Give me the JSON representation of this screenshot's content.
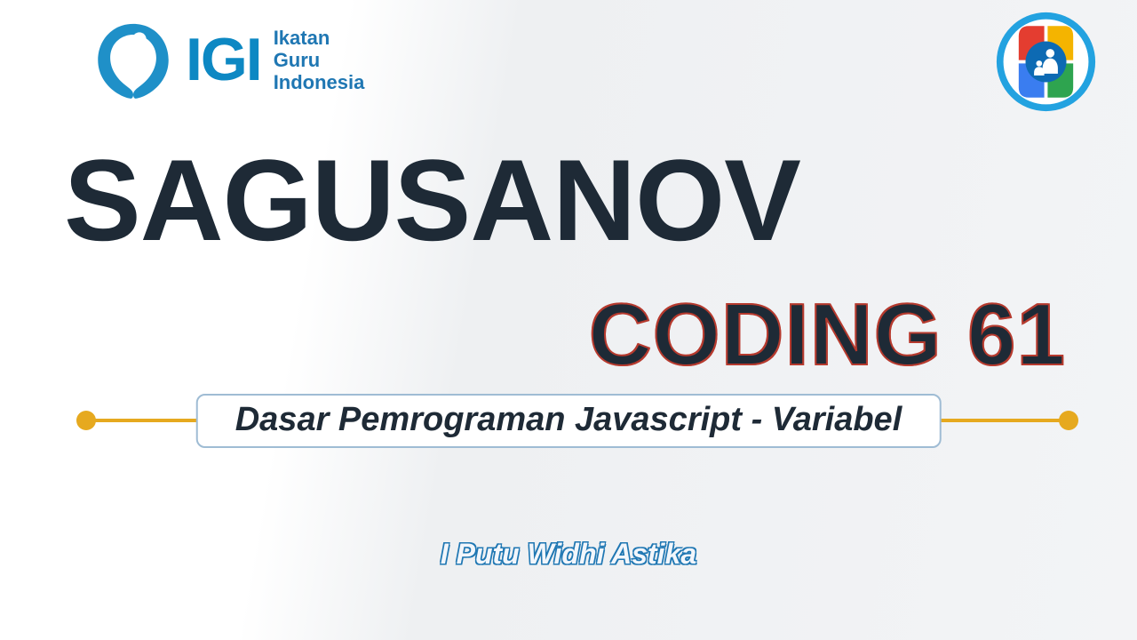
{
  "brand": {
    "acronym": "IGI",
    "full": [
      "Ikatan",
      "Guru",
      "Indonesia"
    ]
  },
  "title": {
    "main": "SAGUSANOV",
    "sub": "CODING 61"
  },
  "subtitle": "Dasar Pemrograman Javascript - Variabel",
  "author": "I Putu Widhi Astika",
  "colors": {
    "accent_yellow": "#e6a91f",
    "brand_blue": "#0d88c3",
    "text_dark": "#1e2a36",
    "red_outline": "#b63a2e"
  }
}
